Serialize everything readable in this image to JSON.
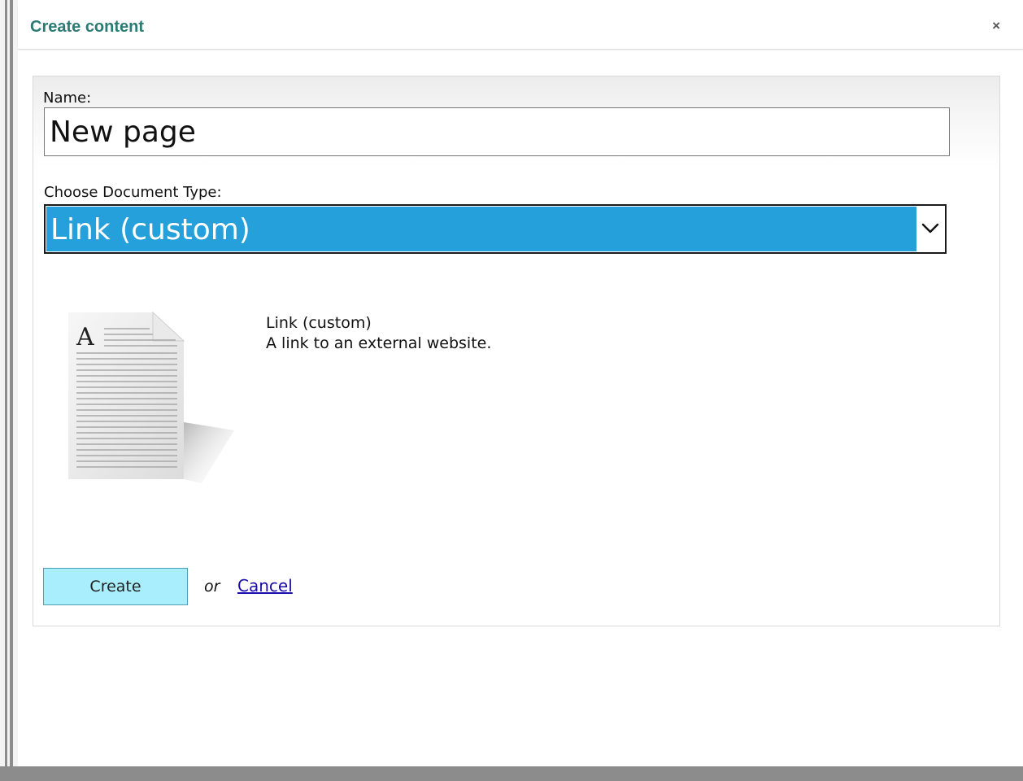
{
  "dialog": {
    "title": "Create content",
    "close_label": "×"
  },
  "form": {
    "name_label": "Name:",
    "name_value": "New page",
    "doctype_label": "Choose Document Type:",
    "doctype_selected": "Link (custom)"
  },
  "description": {
    "icon": "document-icon",
    "title": "Link (custom)",
    "text": "A link to an external website."
  },
  "actions": {
    "create_label": "Create",
    "or_text": "or",
    "cancel_label": "Cancel"
  },
  "colors": {
    "title": "#2c7a74",
    "select_highlight": "#26a0da",
    "create_button": "#a9eefc",
    "link": "#1a0dab"
  }
}
